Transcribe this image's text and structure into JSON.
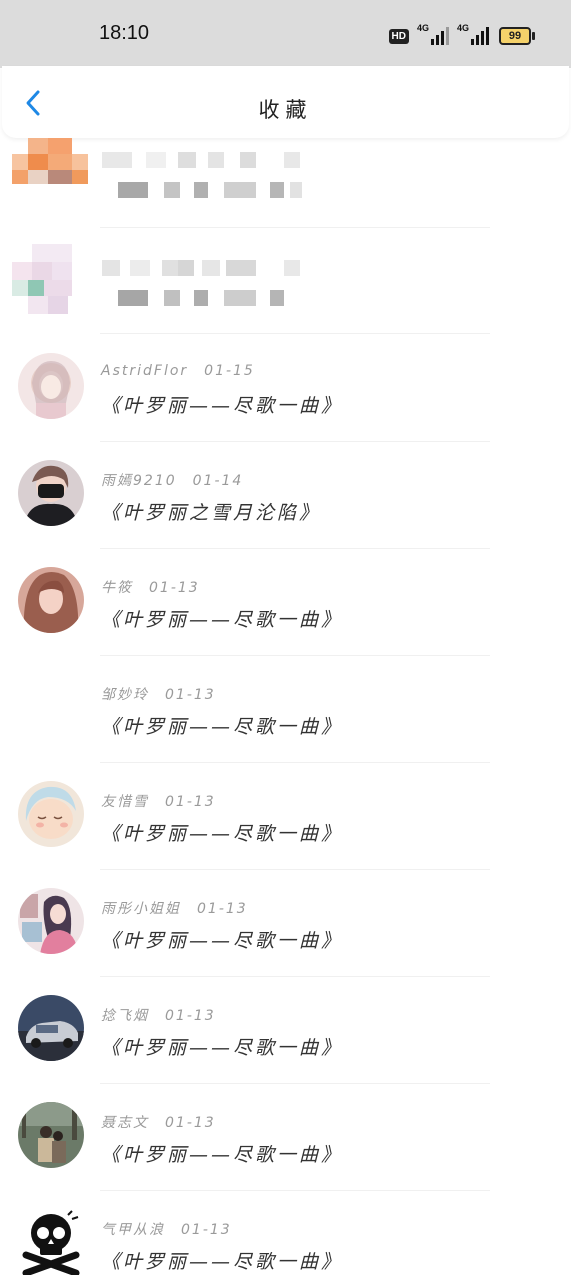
{
  "status_bar": {
    "time": "18:10",
    "hd_label": "HD",
    "net1_label": "4G",
    "net2_label": "4G",
    "battery": "99"
  },
  "header": {
    "title": "收藏"
  },
  "items": [
    {
      "author": "AstridFlor",
      "date": "01-15",
      "title": "《叶罗丽——尽歌一曲》"
    },
    {
      "author": "雨嫣9210",
      "date": "01-14",
      "title": "《叶罗丽之雪月沦陷》"
    },
    {
      "author": "牛筱",
      "date": "01-13",
      "title": "《叶罗丽——尽歌一曲》"
    },
    {
      "author": "邹妙玲",
      "date": "01-13",
      "title": "《叶罗丽——尽歌一曲》"
    },
    {
      "author": "友惜雪",
      "date": "01-13",
      "title": "《叶罗丽——尽歌一曲》"
    },
    {
      "author": "雨彤小姐姐",
      "date": "01-13",
      "title": "《叶罗丽——尽歌一曲》"
    },
    {
      "author": "捻飞烟",
      "date": "01-13",
      "title": "《叶罗丽——尽歌一曲》"
    },
    {
      "author": "聂志文",
      "date": "01-13",
      "title": "《叶罗丽——尽歌一曲》"
    },
    {
      "author": "气甲从浪",
      "date": "01-13",
      "title": "《叶罗丽——尽歌一曲》"
    }
  ]
}
